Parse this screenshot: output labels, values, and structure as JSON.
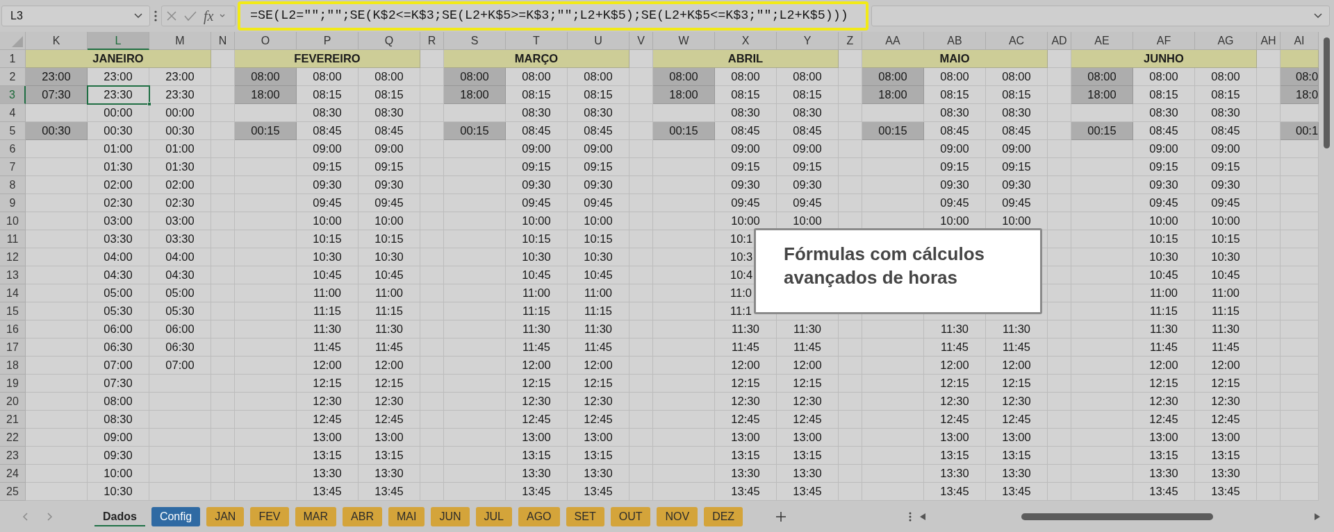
{
  "formula_bar": {
    "name_box": "L3",
    "function_label": "fx",
    "formula": "=SE(L2=\"\";\"\";SE(K$2<=K$3;SE(L2+K$5>=K$3;\"\";L2+K$5);SE(L2+K$5<=K$3;\"\";L2+K$5)))"
  },
  "columns": [
    {
      "label": "K",
      "kind": "input",
      "selected": false
    },
    {
      "label": "L",
      "kind": "time",
      "selected": true
    },
    {
      "label": "M",
      "kind": "time",
      "selected": false
    },
    {
      "label": "N",
      "kind": "spacer",
      "selected": false
    },
    {
      "label": "O",
      "kind": "input",
      "selected": false
    },
    {
      "label": "P",
      "kind": "time",
      "selected": false
    },
    {
      "label": "Q",
      "kind": "time",
      "selected": false
    },
    {
      "label": "R",
      "kind": "spacer",
      "selected": false
    },
    {
      "label": "S",
      "kind": "input",
      "selected": false
    },
    {
      "label": "T",
      "kind": "time",
      "selected": false
    },
    {
      "label": "U",
      "kind": "time",
      "selected": false
    },
    {
      "label": "V",
      "kind": "spacer",
      "selected": false
    },
    {
      "label": "W",
      "kind": "input",
      "selected": false
    },
    {
      "label": "X",
      "kind": "time",
      "selected": false
    },
    {
      "label": "Y",
      "kind": "time",
      "selected": false
    },
    {
      "label": "Z",
      "kind": "spacer",
      "selected": false
    },
    {
      "label": "AA",
      "kind": "input",
      "selected": false
    },
    {
      "label": "AB",
      "kind": "time",
      "selected": false
    },
    {
      "label": "AC",
      "kind": "time",
      "selected": false
    },
    {
      "label": "AD",
      "kind": "spacer",
      "selected": false
    },
    {
      "label": "AE",
      "kind": "input",
      "selected": false
    },
    {
      "label": "AF",
      "kind": "time",
      "selected": false
    },
    {
      "label": "AG",
      "kind": "time",
      "selected": false
    },
    {
      "label": "AH",
      "kind": "spacer",
      "selected": false
    },
    {
      "label": "AI",
      "kind": "input",
      "selected": false
    }
  ],
  "header_row": {
    "number": "1",
    "months": [
      {
        "name": "JANEIRO"
      },
      {
        "name": "FEVEREIRO"
      },
      {
        "name": "MARÇO"
      },
      {
        "name": "ABRIL"
      },
      {
        "name": "MAIO"
      },
      {
        "name": "JUNHO"
      }
    ]
  },
  "rows": [
    {
      "number": "2",
      "selected": false,
      "cells": [
        "23:00",
        "23:00",
        "23:00",
        null,
        "08:00",
        "08:00",
        "08:00",
        null,
        "08:00",
        "08:00",
        "08:00",
        null,
        "08:00",
        "08:00",
        "08:00",
        null,
        "08:00",
        "08:00",
        "08:00",
        null,
        "08:00",
        "08:00",
        "08:00",
        null,
        {
          "text": "08:0",
          "clipped": true
        }
      ]
    },
    {
      "number": "3",
      "selected": true,
      "cells": [
        "07:30",
        "23:30",
        "23:30",
        null,
        "18:00",
        "08:15",
        "08:15",
        null,
        "18:00",
        "08:15",
        "08:15",
        null,
        "18:00",
        "08:15",
        "08:15",
        null,
        "18:00",
        "08:15",
        "08:15",
        null,
        "18:00",
        "08:15",
        "08:15",
        null,
        {
          "text": "18:0",
          "clipped": true
        }
      ]
    },
    {
      "number": "4",
      "selected": false,
      "cells": [
        null,
        "00:00",
        "00:00",
        null,
        null,
        "08:30",
        "08:30",
        null,
        null,
        "08:30",
        "08:30",
        null,
        null,
        "08:30",
        "08:30",
        null,
        null,
        "08:30",
        "08:30",
        null,
        null,
        "08:30",
        "08:30",
        null,
        null
      ]
    },
    {
      "number": "5",
      "selected": false,
      "cells": [
        "00:30",
        "00:30",
        "00:30",
        null,
        "00:15",
        "08:45",
        "08:45",
        null,
        "00:15",
        "08:45",
        "08:45",
        null,
        "00:15",
        "08:45",
        "08:45",
        null,
        "00:15",
        "08:45",
        "08:45",
        null,
        "00:15",
        "08:45",
        "08:45",
        null,
        {
          "text": "00:1",
          "clipped": true
        }
      ]
    },
    {
      "number": "6",
      "selected": false,
      "cells": [
        null,
        "01:00",
        "01:00",
        null,
        null,
        "09:00",
        "09:00",
        null,
        null,
        "09:00",
        "09:00",
        null,
        null,
        "09:00",
        "09:00",
        null,
        null,
        "09:00",
        "09:00",
        null,
        null,
        "09:00",
        "09:00",
        null,
        null
      ]
    },
    {
      "number": "7",
      "selected": false,
      "cells": [
        null,
        "01:30",
        "01:30",
        null,
        null,
        "09:15",
        "09:15",
        null,
        null,
        "09:15",
        "09:15",
        null,
        null,
        "09:15",
        "09:15",
        null,
        null,
        "09:15",
        "09:15",
        null,
        null,
        "09:15",
        "09:15",
        null,
        null
      ]
    },
    {
      "number": "8",
      "selected": false,
      "cells": [
        null,
        "02:00",
        "02:00",
        null,
        null,
        "09:30",
        "09:30",
        null,
        null,
        "09:30",
        "09:30",
        null,
        null,
        "09:30",
        "09:30",
        null,
        null,
        "09:30",
        "09:30",
        null,
        null,
        "09:30",
        "09:30",
        null,
        null
      ]
    },
    {
      "number": "9",
      "selected": false,
      "cells": [
        null,
        "02:30",
        "02:30",
        null,
        null,
        "09:45",
        "09:45",
        null,
        null,
        "09:45",
        "09:45",
        null,
        null,
        "09:45",
        "09:45",
        null,
        null,
        "09:45",
        "09:45",
        null,
        null,
        "09:45",
        "09:45",
        null,
        null
      ]
    },
    {
      "number": "10",
      "selected": false,
      "cells": [
        null,
        "03:00",
        "03:00",
        null,
        null,
        "10:00",
        "10:00",
        null,
        null,
        "10:00",
        "10:00",
        null,
        null,
        "10:00",
        "10:00",
        null,
        null,
        "10:00",
        "10:00",
        null,
        null,
        "10:00",
        "10:00",
        null,
        null
      ]
    },
    {
      "number": "11",
      "selected": false,
      "cells": [
        null,
        "03:30",
        "03:30",
        null,
        null,
        "10:15",
        "10:15",
        null,
        null,
        "10:15",
        "10:15",
        null,
        null,
        {
          "text": "10:1",
          "clipped": true
        },
        null,
        null,
        null,
        null,
        null,
        null,
        null,
        "10:15",
        "10:15",
        null,
        null
      ]
    },
    {
      "number": "12",
      "selected": false,
      "cells": [
        null,
        "04:00",
        "04:00",
        null,
        null,
        "10:30",
        "10:30",
        null,
        null,
        "10:30",
        "10:30",
        null,
        null,
        {
          "text": "10:3",
          "clipped": true
        },
        null,
        null,
        null,
        null,
        null,
        null,
        null,
        "10:30",
        "10:30",
        null,
        null
      ]
    },
    {
      "number": "13",
      "selected": false,
      "cells": [
        null,
        "04:30",
        "04:30",
        null,
        null,
        "10:45",
        "10:45",
        null,
        null,
        "10:45",
        "10:45",
        null,
        null,
        {
          "text": "10:4",
          "clipped": true
        },
        null,
        null,
        null,
        null,
        null,
        null,
        null,
        "10:45",
        "10:45",
        null,
        null
      ]
    },
    {
      "number": "14",
      "selected": false,
      "cells": [
        null,
        "05:00",
        "05:00",
        null,
        null,
        "11:00",
        "11:00",
        null,
        null,
        "11:00",
        "11:00",
        null,
        null,
        {
          "text": "11:0",
          "clipped": true
        },
        null,
        null,
        null,
        null,
        null,
        null,
        null,
        "11:00",
        "11:00",
        null,
        null
      ]
    },
    {
      "number": "15",
      "selected": false,
      "cells": [
        null,
        "05:30",
        "05:30",
        null,
        null,
        "11:15",
        "11:15",
        null,
        null,
        "11:15",
        "11:15",
        null,
        null,
        {
          "text": "11:1",
          "clipped": true
        },
        null,
        null,
        null,
        null,
        null,
        null,
        null,
        "11:15",
        "11:15",
        null,
        null
      ]
    },
    {
      "number": "16",
      "selected": false,
      "cells": [
        null,
        "06:00",
        "06:00",
        null,
        null,
        "11:30",
        "11:30",
        null,
        null,
        "11:30",
        "11:30",
        null,
        null,
        "11:30",
        "11:30",
        null,
        null,
        "11:30",
        "11:30",
        null,
        null,
        "11:30",
        "11:30",
        null,
        null
      ]
    },
    {
      "number": "17",
      "selected": false,
      "cells": [
        null,
        "06:30",
        "06:30",
        null,
        null,
        "11:45",
        "11:45",
        null,
        null,
        "11:45",
        "11:45",
        null,
        null,
        "11:45",
        "11:45",
        null,
        null,
        "11:45",
        "11:45",
        null,
        null,
        "11:45",
        "11:45",
        null,
        null
      ]
    },
    {
      "number": "18",
      "selected": false,
      "cells": [
        null,
        "07:00",
        "07:00",
        null,
        null,
        "12:00",
        "12:00",
        null,
        null,
        "12:00",
        "12:00",
        null,
        null,
        "12:00",
        "12:00",
        null,
        null,
        "12:00",
        "12:00",
        null,
        null,
        "12:00",
        "12:00",
        null,
        null
      ]
    },
    {
      "number": "19",
      "selected": false,
      "cells": [
        null,
        "07:30",
        null,
        null,
        null,
        "12:15",
        "12:15",
        null,
        null,
        "12:15",
        "12:15",
        null,
        null,
        "12:15",
        "12:15",
        null,
        null,
        "12:15",
        "12:15",
        null,
        null,
        "12:15",
        "12:15",
        null,
        null
      ]
    },
    {
      "number": "20",
      "selected": false,
      "cells": [
        null,
        "08:00",
        null,
        null,
        null,
        "12:30",
        "12:30",
        null,
        null,
        "12:30",
        "12:30",
        null,
        null,
        "12:30",
        "12:30",
        null,
        null,
        "12:30",
        "12:30",
        null,
        null,
        "12:30",
        "12:30",
        null,
        null
      ]
    },
    {
      "number": "21",
      "selected": false,
      "cells": [
        null,
        "08:30",
        null,
        null,
        null,
        "12:45",
        "12:45",
        null,
        null,
        "12:45",
        "12:45",
        null,
        null,
        "12:45",
        "12:45",
        null,
        null,
        "12:45",
        "12:45",
        null,
        null,
        "12:45",
        "12:45",
        null,
        null
      ]
    },
    {
      "number": "22",
      "selected": false,
      "cells": [
        null,
        "09:00",
        null,
        null,
        null,
        "13:00",
        "13:00",
        null,
        null,
        "13:00",
        "13:00",
        null,
        null,
        "13:00",
        "13:00",
        null,
        null,
        "13:00",
        "13:00",
        null,
        null,
        "13:00",
        "13:00",
        null,
        null
      ]
    },
    {
      "number": "23",
      "selected": false,
      "cells": [
        null,
        "09:30",
        null,
        null,
        null,
        "13:15",
        "13:15",
        null,
        null,
        "13:15",
        "13:15",
        null,
        null,
        "13:15",
        "13:15",
        null,
        null,
        "13:15",
        "13:15",
        null,
        null,
        "13:15",
        "13:15",
        null,
        null
      ]
    },
    {
      "number": "24",
      "selected": false,
      "cells": [
        null,
        "10:00",
        null,
        null,
        null,
        "13:30",
        "13:30",
        null,
        null,
        "13:30",
        "13:30",
        null,
        null,
        "13:30",
        "13:30",
        null,
        null,
        "13:30",
        "13:30",
        null,
        null,
        "13:30",
        "13:30",
        null,
        null
      ]
    },
    {
      "number": "25",
      "selected": false,
      "cells": [
        null,
        "10:30",
        null,
        null,
        null,
        "13:45",
        "13:45",
        null,
        null,
        "13:45",
        "13:45",
        null,
        null,
        "13:45",
        "13:45",
        null,
        null,
        "13:45",
        "13:45",
        null,
        null,
        "13:45",
        "13:45",
        null,
        null
      ]
    }
  ],
  "callout": {
    "text": "Fórmulas com cálculos avançados de horas"
  },
  "sheet_tabs": [
    {
      "label": "Dados",
      "selected": true
    },
    {
      "label": "Config",
      "selected": false,
      "color": "#2f6aa3"
    },
    {
      "label": "JAN",
      "selected": false,
      "color": "#d4a43a"
    },
    {
      "label": "FEV",
      "selected": false,
      "color": "#d4a43a"
    },
    {
      "label": "MAR",
      "selected": false,
      "color": "#d4a43a"
    },
    {
      "label": "ABR",
      "selected": false,
      "color": "#d4a43a"
    },
    {
      "label": "MAI",
      "selected": false,
      "color": "#d4a43a"
    },
    {
      "label": "JUN",
      "selected": false,
      "color": "#d4a43a"
    },
    {
      "label": "JUL",
      "selected": false,
      "color": "#d4a43a"
    },
    {
      "label": "AGO",
      "selected": false,
      "color": "#d4a43a"
    },
    {
      "label": "SET",
      "selected": false,
      "color": "#d4a43a"
    },
    {
      "label": "OUT",
      "selected": false,
      "color": "#d4a43a"
    },
    {
      "label": "NOV",
      "selected": false,
      "color": "#d4a43a"
    },
    {
      "label": "DEZ",
      "selected": false,
      "color": "#d4a43a"
    }
  ]
}
